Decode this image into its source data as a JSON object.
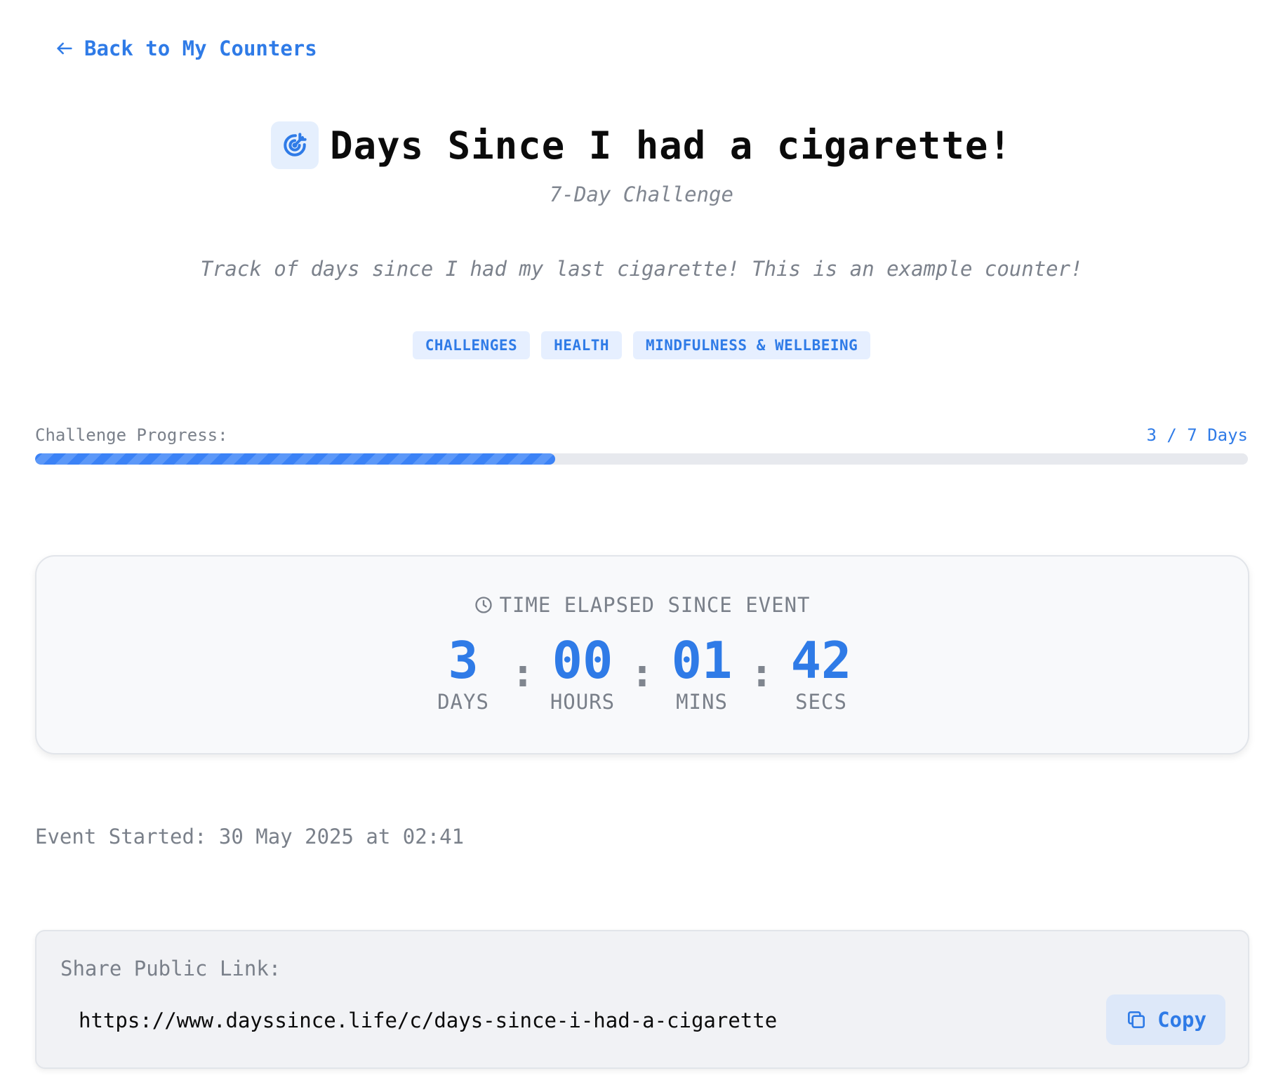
{
  "nav": {
    "back_label": "Back to My Counters",
    "back_icon": "arrow-left-icon"
  },
  "header": {
    "icon": "target-icon",
    "title": "Days Since I had a cigarette!",
    "subtitle": "7-Day Challenge",
    "description": "Track of days since I had my last cigarette! This is an example counter!"
  },
  "tags": [
    "CHALLENGES",
    "HEALTH",
    "MINDFULNESS & WELLBEING"
  ],
  "progress": {
    "label": "Challenge Progress:",
    "value_text": "3 / 7 Days",
    "current": 3,
    "total": 7
  },
  "timer": {
    "heading": "TIME ELAPSED SINCE EVENT",
    "heading_icon": "clock-icon",
    "separator": ":",
    "units": [
      {
        "value": "3",
        "label": "DAYS"
      },
      {
        "value": "00",
        "label": "HOURS"
      },
      {
        "value": "01",
        "label": "MINS"
      },
      {
        "value": "42",
        "label": "SECS"
      }
    ]
  },
  "event": {
    "started_text": "Event Started: 30 May 2025 at 02:41"
  },
  "share": {
    "label": "Share Public Link:",
    "url": "https://www.dayssince.life/c/days-since-i-had-a-cigarette",
    "copy_label": "Copy",
    "copy_icon": "copy-icon"
  },
  "colors": {
    "accent": "#2f7be7",
    "muted_text": "#7a808a",
    "tag_bg": "#e6efff",
    "progress_track": "#e7e9ee"
  }
}
